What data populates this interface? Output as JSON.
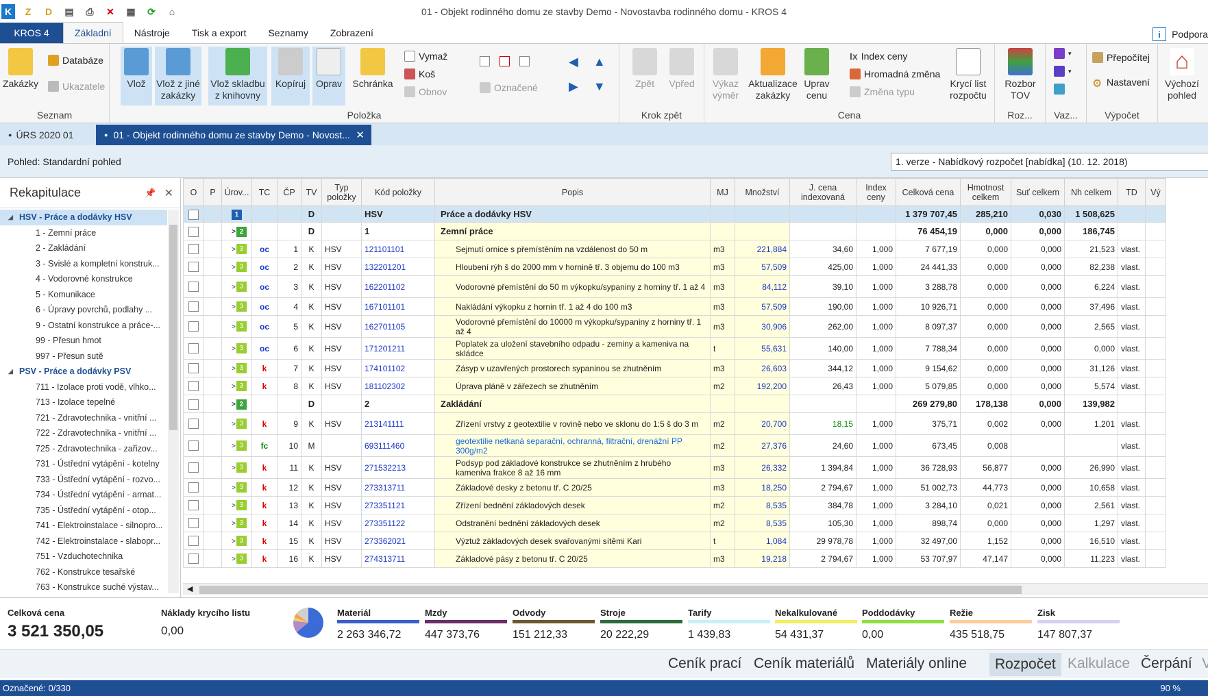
{
  "window": {
    "title": "01 - Objekt rodinného domu ze stavby Demo - Novostavba rodinného domu  - KROS 4"
  },
  "ribbon_tabs": {
    "app": "KROS 4",
    "tabs": [
      "Základní",
      "Nástroje",
      "Tisk a export",
      "Seznamy",
      "Zobrazení"
    ],
    "support": "Podpora"
  },
  "ribbon": {
    "seznam": {
      "label": "Seznam",
      "zakazky": "Zakázky",
      "databaze": "Databáze",
      "ukazatele": "Ukazatele"
    },
    "polozka": {
      "label": "Položka",
      "vloz": "Vlož",
      "vloz_jine": "Vlož z jiné zakázky",
      "vloz_sklad": "Vlož skladbu z knihovny",
      "kopiruj": "Kopíruj",
      "oprav": "Oprav",
      "schranka": "Schránka",
      "vymaz": "Vymaž",
      "kos": "Koš",
      "obnov": "Obnov",
      "oznacene": "Označené"
    },
    "krok": {
      "label": "Krok zpět",
      "zpet": "Zpět",
      "vpred": "Vpřed"
    },
    "cena": {
      "label": "Cena",
      "vykaz": "Výkaz výměr",
      "aktualizace": "Aktualizace zakázky",
      "uprav": "Uprav cenu",
      "index": "Index ceny",
      "hromadna": "Hromadná změna",
      "zmena": "Změna typu",
      "kryci": "Krycí list rozpočtu"
    },
    "roz": {
      "label": "Roz...",
      "rozbor": "Rozbor TOV"
    },
    "vaz": {
      "label": "Vaz..."
    },
    "vypocet": {
      "label": "Výpočet",
      "prepocitej": "Přepočítej",
      "nastaveni": "Nastavení"
    },
    "vychozi": {
      "label": "Výchozí pohled"
    }
  },
  "doc_tabs": {
    "urs": "ÚRS 2020 01",
    "active": "01 - Objekt rodinného domu ze stavby Demo - Novost..."
  },
  "view": {
    "label": "Pohled: Standardní pohled",
    "version": "1. verze - Nabídkový rozpočet [nabídka] (10. 12. 2018)"
  },
  "sidebar": {
    "title": "Rekapitulace",
    "items": [
      {
        "level": 0,
        "label": "HSV - Práce a dodávky HSV"
      },
      {
        "level": 1,
        "label": "1 - Zemní práce"
      },
      {
        "level": 1,
        "label": "2 - Zakládání"
      },
      {
        "level": 1,
        "label": "3 - Svislé a kompletní konstruk..."
      },
      {
        "level": 1,
        "label": "4 - Vodorovné konstrukce"
      },
      {
        "level": 1,
        "label": "5 - Komunikace"
      },
      {
        "level": 1,
        "label": "6 - Úpravy povrchů, podlahy ..."
      },
      {
        "level": 1,
        "label": "9 - Ostatní konstrukce a práce-..."
      },
      {
        "level": 1,
        "label": "99 - Přesun hmot"
      },
      {
        "level": 1,
        "label": "997 - Přesun sutě"
      },
      {
        "level": 0,
        "label": "PSV - Práce a dodávky PSV"
      },
      {
        "level": 1,
        "label": "711 - Izolace proti vodě, vlhko..."
      },
      {
        "level": 1,
        "label": "713 - Izolace tepelné"
      },
      {
        "level": 1,
        "label": "721 - Zdravotechnika - vnitřní ..."
      },
      {
        "level": 1,
        "label": "722 - Zdravotechnika - vnitřní ..."
      },
      {
        "level": 1,
        "label": "725 - Zdravotechnika - zařizov..."
      },
      {
        "level": 1,
        "label": "731 - Ústřední vytápění - kotelny"
      },
      {
        "level": 1,
        "label": "733 - Ústřední vytápění - rozvo..."
      },
      {
        "level": 1,
        "label": "734 - Ústřední vytápění - armat..."
      },
      {
        "level": 1,
        "label": "735 - Ústřední vytápění - otop..."
      },
      {
        "level": 1,
        "label": "741 - Elektroinstalace - silnopro..."
      },
      {
        "level": 1,
        "label": "742 - Elektroinstalace - slabopr..."
      },
      {
        "level": 1,
        "label": "751 - Vzduchotechnika"
      },
      {
        "level": 1,
        "label": "762 - Konstrukce tesařské"
      },
      {
        "level": 1,
        "label": "763 - Konstrukce suché výstav..."
      }
    ]
  },
  "table": {
    "columns": [
      "O",
      "P",
      "Úrov...",
      "TC",
      "ČP",
      "TV",
      "Typ položky",
      "Kód položky",
      "Popis",
      "MJ",
      "Množství",
      "J. cena indexovaná",
      "Index ceny",
      "Celková cena",
      "Hmotnost celkem",
      "Suť celkem",
      "Nh celkem",
      "TD",
      "Vý"
    ],
    "rows": [
      {
        "kind": "r1",
        "lvl": "1",
        "tv": "D",
        "code": "HSV",
        "popis": "Práce a dodávky HSV",
        "celkova": "1 379 707,45",
        "hmot": "285,210",
        "sut": "0,030",
        "nh": "1 508,625"
      },
      {
        "kind": "r2",
        "lvl": "2",
        "tv": "D",
        "code": "1",
        "popis": "Zemní práce",
        "celkova": "76 454,19",
        "hmot": "0,000",
        "sut": "0,000",
        "nh": "186,745"
      },
      {
        "kind": "r3",
        "lvl": "3",
        "tc": "oc",
        "cp": "1",
        "tv": "K",
        "typ": "HSV",
        "code": "121101101",
        "popis": "Sejmutí ornice s přemístěním na vzdálenost do 50 m",
        "mj": "m3",
        "mn": "221,884",
        "jc": "34,60",
        "idx": "1,000",
        "celkova": "7 677,19",
        "hmot": "0,000",
        "sut": "0,000",
        "nh": "21,523",
        "td": "vlast."
      },
      {
        "kind": "r3",
        "lvl": "3",
        "tc": "oc",
        "cp": "2",
        "tv": "K",
        "typ": "HSV",
        "code": "132201201",
        "popis": "Hloubení rýh š do 2000 mm v hornině tř. 3 objemu do 100 m3",
        "mj": "m3",
        "mn": "57,509",
        "jc": "425,00",
        "idx": "1,000",
        "celkova": "24 441,33",
        "hmot": "0,000",
        "sut": "0,000",
        "nh": "82,238",
        "td": "vlast."
      },
      {
        "kind": "r3",
        "tall": true,
        "lvl": "3",
        "tc": "oc",
        "cp": "3",
        "tv": "K",
        "typ": "HSV",
        "code": "162201102",
        "popis": "Vodorovné přemístění do 50 m výkopku/sypaniny z horniny tř. 1 až 4",
        "mj": "m3",
        "mn": "84,112",
        "jc": "39,10",
        "idx": "1,000",
        "celkova": "3 288,78",
        "hmot": "0,000",
        "sut": "0,000",
        "nh": "6,224",
        "td": "vlast."
      },
      {
        "kind": "r3",
        "lvl": "3",
        "tc": "oc",
        "cp": "4",
        "tv": "K",
        "typ": "HSV",
        "code": "167101101",
        "popis": "Nakládání výkopku z hornin tř. 1 až 4 do 100 m3",
        "mj": "m3",
        "mn": "57,509",
        "jc": "190,00",
        "idx": "1,000",
        "celkova": "10 926,71",
        "hmot": "0,000",
        "sut": "0,000",
        "nh": "37,496",
        "td": "vlast."
      },
      {
        "kind": "r3",
        "tall": true,
        "lvl": "3",
        "tc": "oc",
        "cp": "5",
        "tv": "K",
        "typ": "HSV",
        "code": "162701105",
        "popis": "Vodorovné přemístění do 10000 m výkopku/sypaniny z horniny tř. 1 až 4",
        "mj": "m3",
        "mn": "30,906",
        "jc": "262,00",
        "idx": "1,000",
        "celkova": "8 097,37",
        "hmot": "0,000",
        "sut": "0,000",
        "nh": "2,565",
        "td": "vlast."
      },
      {
        "kind": "r3",
        "tall": true,
        "lvl": "3",
        "tc": "oc",
        "cp": "6",
        "tv": "K",
        "typ": "HSV",
        "code": "171201211",
        "popis": "Poplatek za uložení stavebního odpadu - zeminy a kameniva na skládce",
        "mj": "t",
        "mn": "55,631",
        "jc": "140,00",
        "idx": "1,000",
        "celkova": "7 788,34",
        "hmot": "0,000",
        "sut": "0,000",
        "nh": "0,000",
        "td": "vlast."
      },
      {
        "kind": "r3",
        "lvl": "3",
        "tc": "k",
        "cp": "7",
        "tv": "K",
        "typ": "HSV",
        "code": "174101102",
        "popis": "Zásyp v uzavřených prostorech sypaninou se zhutněním",
        "mj": "m3",
        "mn": "26,603",
        "jc": "344,12",
        "idx": "1,000",
        "celkova": "9 154,62",
        "hmot": "0,000",
        "sut": "0,000",
        "nh": "31,126",
        "td": "vlast."
      },
      {
        "kind": "r3",
        "lvl": "3",
        "tc": "k",
        "cp": "8",
        "tv": "K",
        "typ": "HSV",
        "code": "181102302",
        "popis": "Úprava pláně v zářezech se zhutněním",
        "mj": "m2",
        "mn": "192,200",
        "jc": "26,43",
        "idx": "1,000",
        "celkova": "5 079,85",
        "hmot": "0,000",
        "sut": "0,000",
        "nh": "5,574",
        "td": "vlast."
      },
      {
        "kind": "r2",
        "lvl": "2",
        "tv": "D",
        "code": "2",
        "popis": "Zakládání",
        "celkova": "269 279,80",
        "hmot": "178,138",
        "sut": "0,000",
        "nh": "139,982"
      },
      {
        "kind": "r3",
        "tall": true,
        "lvl": "3",
        "tc": "k",
        "cp": "9",
        "tv": "K",
        "typ": "HSV",
        "code": "213141111",
        "popis": "Zřízení vrstvy z geotextilie v rovině nebo ve sklonu do 1:5 š do 3 m",
        "mj": "m2",
        "mn": "20,700",
        "jc": "18,15",
        "jcgreen": true,
        "idx": "1,000",
        "celkova": "375,71",
        "hmot": "0,002",
        "sut": "0,000",
        "nh": "1,201",
        "td": "vlast."
      },
      {
        "kind": "r3",
        "tall": true,
        "lvl": "3",
        "tc": "fc",
        "cp": "10",
        "tv": "M",
        "typ": "",
        "code": "693111460",
        "popis": "geotextilie netkaná separační, ochranná, filtrační, drenážní PP 300g/m2",
        "popisblue": true,
        "mj": "m2",
        "mn": "27,376",
        "jc": "24,60",
        "idx": "1,000",
        "celkova": "673,45",
        "hmot": "0,008",
        "sut": "",
        "nh": "",
        "td": "vlast."
      },
      {
        "kind": "r3",
        "tall": true,
        "lvl": "3",
        "tc": "k",
        "cp": "11",
        "tv": "K",
        "typ": "HSV",
        "code": "271532213",
        "popis": "Podsyp pod základové konstrukce se zhutněním z hrubého kameniva frakce 8 až 16 mm",
        "mj": "m3",
        "mn": "26,332",
        "jc": "1 394,84",
        "idx": "1,000",
        "celkova": "36 728,93",
        "hmot": "56,877",
        "sut": "0,000",
        "nh": "26,990",
        "td": "vlast."
      },
      {
        "kind": "r3",
        "lvl": "3",
        "tc": "k",
        "cp": "12",
        "tv": "K",
        "typ": "HSV",
        "code": "273313711",
        "popis": "Základové desky z betonu tř. C 20/25",
        "mj": "m3",
        "mn": "18,250",
        "jc": "2 794,67",
        "idx": "1,000",
        "celkova": "51 002,73",
        "hmot": "44,773",
        "sut": "0,000",
        "nh": "10,658",
        "td": "vlast."
      },
      {
        "kind": "r3",
        "lvl": "3",
        "tc": "k",
        "cp": "13",
        "tv": "K",
        "typ": "HSV",
        "code": "273351121",
        "popis": "Zřízení bednění základových desek",
        "mj": "m2",
        "mn": "8,535",
        "jc": "384,78",
        "idx": "1,000",
        "celkova": "3 284,10",
        "hmot": "0,021",
        "sut": "0,000",
        "nh": "2,561",
        "td": "vlast."
      },
      {
        "kind": "r3",
        "lvl": "3",
        "tc": "k",
        "cp": "14",
        "tv": "K",
        "typ": "HSV",
        "code": "273351122",
        "popis": "Odstranění bednění základových desek",
        "mj": "m2",
        "mn": "8,535",
        "jc": "105,30",
        "idx": "1,000",
        "celkova": "898,74",
        "hmot": "0,000",
        "sut": "0,000",
        "nh": "1,297",
        "td": "vlast."
      },
      {
        "kind": "r3",
        "lvl": "3",
        "tc": "k",
        "cp": "15",
        "tv": "K",
        "typ": "HSV",
        "code": "273362021",
        "popis": "Výztuž základových desek svařovanými sítěmi Kari",
        "mj": "t",
        "mn": "1,084",
        "jc": "29 978,78",
        "idx": "1,000",
        "celkova": "32 497,00",
        "hmot": "1,152",
        "sut": "0,000",
        "nh": "16,510",
        "td": "vlast."
      },
      {
        "kind": "r3",
        "lvl": "3",
        "tc": "k",
        "cp": "16",
        "tv": "K",
        "typ": "HSV",
        "code": "274313711",
        "popis": "Základové pásy z betonu tř. C 20/25",
        "mj": "m3",
        "mn": "19,218",
        "jc": "2 794,67",
        "idx": "1,000",
        "celkova": "53 707,97",
        "hmot": "47,147",
        "sut": "0,000",
        "nh": "11,223",
        "td": "vlast."
      }
    ]
  },
  "summary": {
    "total_label": "Celková cena",
    "total": "3 521 350,05",
    "kryci_label": "Náklady krycího listu",
    "kryci": "0,00",
    "items": [
      {
        "label": "Materiál",
        "value": "2 263 346,72",
        "color": "#3b5fc8"
      },
      {
        "label": "Mzdy",
        "value": "447 373,76",
        "color": "#6b2e6b"
      },
      {
        "label": "Odvody",
        "value": "151 212,33",
        "color": "#6b5a2e"
      },
      {
        "label": "Stroje",
        "value": "20 222,29",
        "color": "#2e6b3b"
      },
      {
        "label": "Tarify",
        "value": "1 439,83",
        "color": "#c8f0f8"
      },
      {
        "label": "Nekalkulované",
        "value": "54 431,37",
        "color": "#f0f060"
      },
      {
        "label": "Poddodávky",
        "value": "0,00",
        "color": "#90e040"
      },
      {
        "label": "Režie",
        "value": "435 518,75",
        "color": "#ffcc99"
      },
      {
        "label": "Zisk",
        "value": "147 807,37",
        "color": "#d8d0f0"
      }
    ]
  },
  "modules": [
    "Ceník prací",
    "Ceník materiálů",
    "Materiály online",
    "Rozpočet",
    "Kalkulace",
    "Čerpání",
    "V"
  ],
  "status": {
    "left": "Označené: 0/330",
    "zoom": "90 %"
  }
}
